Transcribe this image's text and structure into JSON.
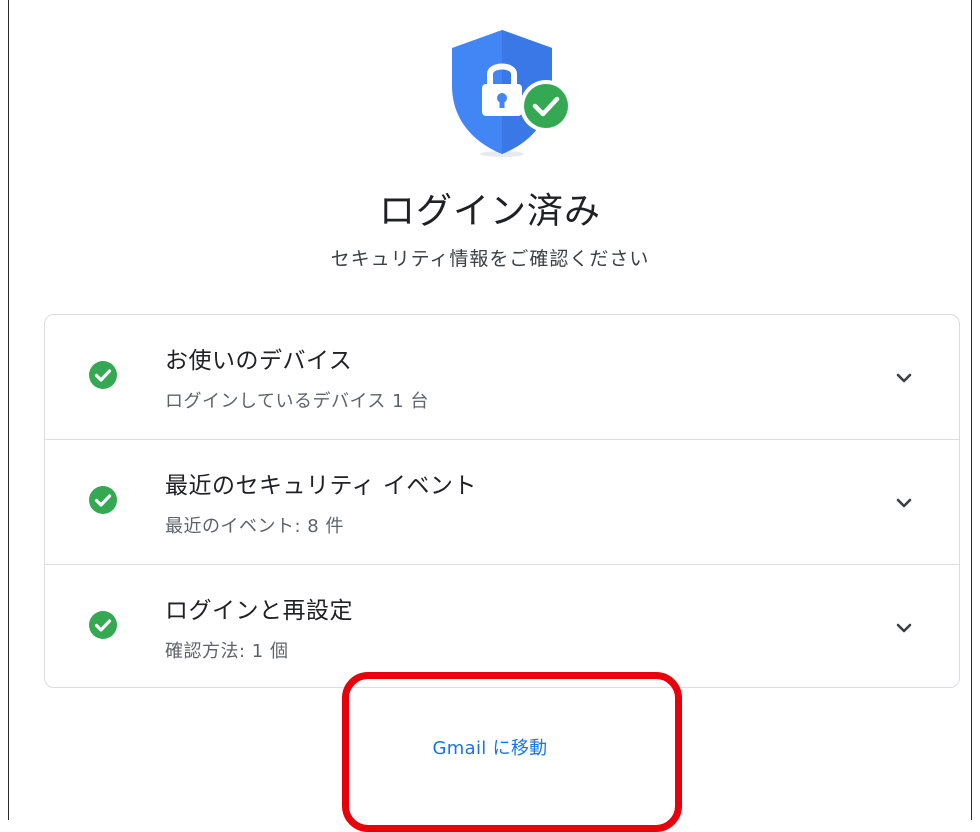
{
  "header": {
    "title": "ログイン済み",
    "subtitle": "セキュリティ情報をご確認ください"
  },
  "security_items": [
    {
      "title": "お使いのデバイス",
      "subtitle": "ログインしているデバイス 1 台",
      "status": "ok"
    },
    {
      "title": "最近のセキュリティ イベント",
      "subtitle": "最近のイベント: 8 件",
      "status": "ok"
    },
    {
      "title": "ログインと再設定",
      "subtitle": "確認方法: 1 個",
      "status": "ok"
    }
  ],
  "footer": {
    "gmail_link": "Gmail に移動"
  },
  "colors": {
    "shield": "#4285f4",
    "check": "#34a853",
    "link": "#1a73e8",
    "highlight": "#e8000b"
  },
  "icons": [
    "shield-lock-icon",
    "check-circle-icon",
    "chevron-down-icon"
  ]
}
